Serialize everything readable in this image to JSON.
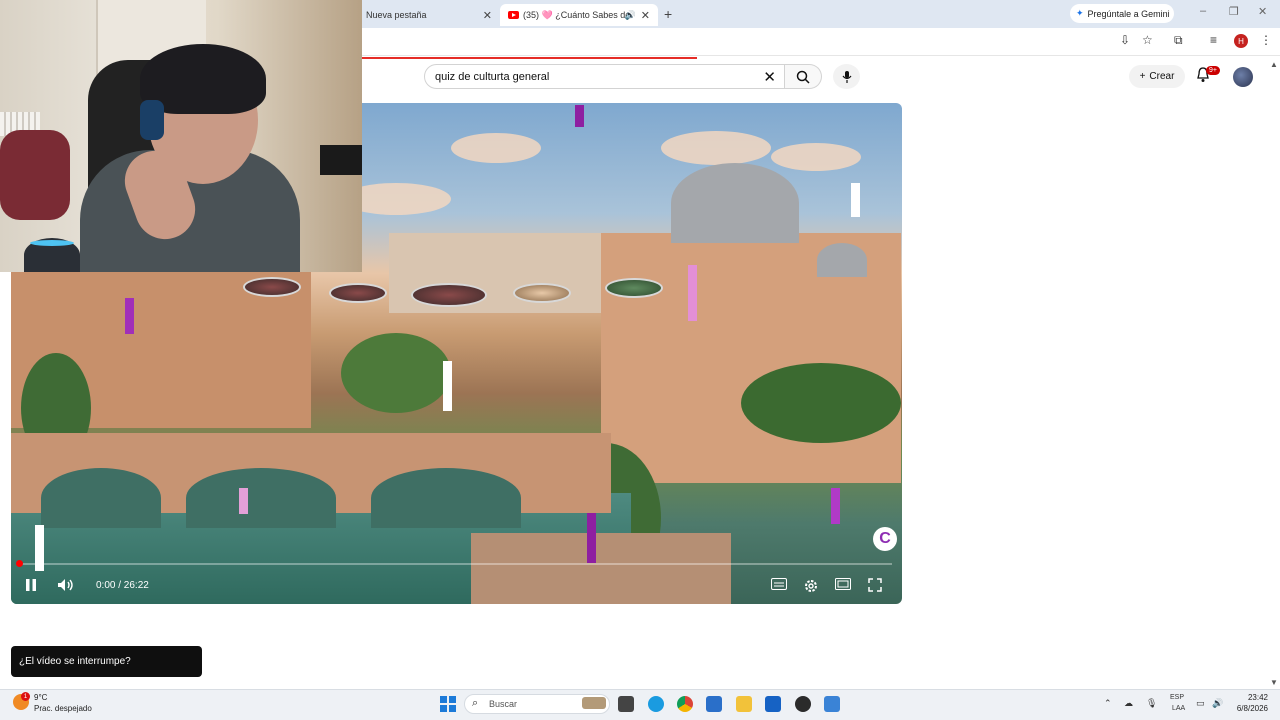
{
  "browser": {
    "tabs": [
      {
        "title": "Nueva pestaña",
        "active": false
      },
      {
        "title": "(35) 🩷 ¿Cuánto Sabes de",
        "active": true
      }
    ],
    "gemini_label": "Pregúntale a Gemini",
    "profile_initial": "H"
  },
  "youtube": {
    "search": {
      "value": "quiz de culturta general"
    },
    "create_label": "Crear",
    "notifications_badge": "9+",
    "player": {
      "time": "0:00 / 26:22",
      "channel_logo": "C",
      "state": "playing"
    },
    "toast": "¿El vídeo se interrumpe?"
  },
  "taskbar": {
    "weather_temp": "9°C",
    "weather_desc": "Prac. despejado",
    "weather_badge": "1",
    "search_placeholder": "Buscar",
    "lang_line1": "ESP",
    "lang_line2": "LAA",
    "time": "23:42",
    "date": "6/8/2026"
  },
  "colors": {
    "accent_red": "#e52d27",
    "chrome_bg": "#dfe7f2",
    "taskbar_bg": "#eef1f5"
  }
}
